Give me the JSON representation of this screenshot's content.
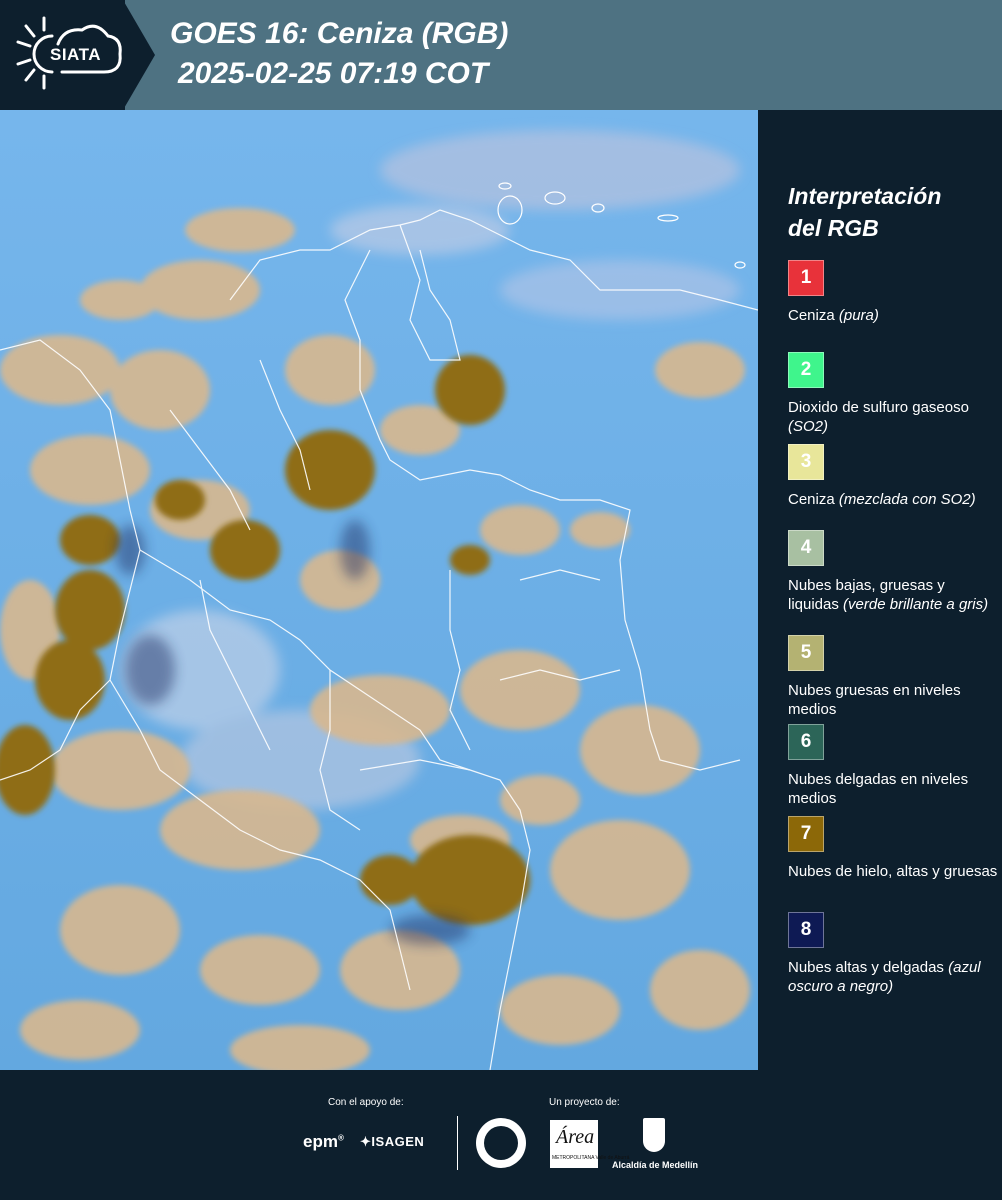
{
  "header": {
    "logo_text": "SIATA",
    "title_line1": "GOES 16: Ceniza (RGB)",
    "title_line2": "2025-02-25 07:19 COT"
  },
  "legend": {
    "title_line1": "Interpretación",
    "title_line2": "del RGB",
    "items": [
      {
        "number": "1",
        "color": "#e8323a",
        "text": "Ceniza",
        "note": "(pura)"
      },
      {
        "number": "2",
        "color": "#3ff58c",
        "text": "Dioxido de sulfuro gaseoso",
        "note": "(SO2)"
      },
      {
        "number": "3",
        "color": "#e8e69a",
        "text": "Ceniza",
        "note": "(mezclada con SO2)"
      },
      {
        "number": "4",
        "color": "#a8c0a2",
        "text": "Nubes bajas, gruesas y liquidas",
        "note": "(verde brillante a gris)"
      },
      {
        "number": "5",
        "color": "#b4b272",
        "text": "Nubes gruesas en niveles medios",
        "note": ""
      },
      {
        "number": "6",
        "color": "#2c6558",
        "text": "Nubes delgadas en niveles medios",
        "note": ""
      },
      {
        "number": "7",
        "color": "#8c6808",
        "text": "Nubes de hielo, altas y gruesas",
        "note": ""
      },
      {
        "number": "8",
        "color": "#0e1a54",
        "text": "Nubes altas y delgadas",
        "note": "(azul oscuro a negro)"
      }
    ]
  },
  "footer": {
    "support_label": "Con el apoyo de:",
    "project_label": "Un proyecto de:",
    "sponsor1": "epm",
    "sponsor2": "ISAGEN",
    "partner_area": "Área",
    "partner_area_sub": "METROPOLITANA Valle de Aburrá",
    "partner_alcaldia": "Alcaldía de Medellín"
  }
}
